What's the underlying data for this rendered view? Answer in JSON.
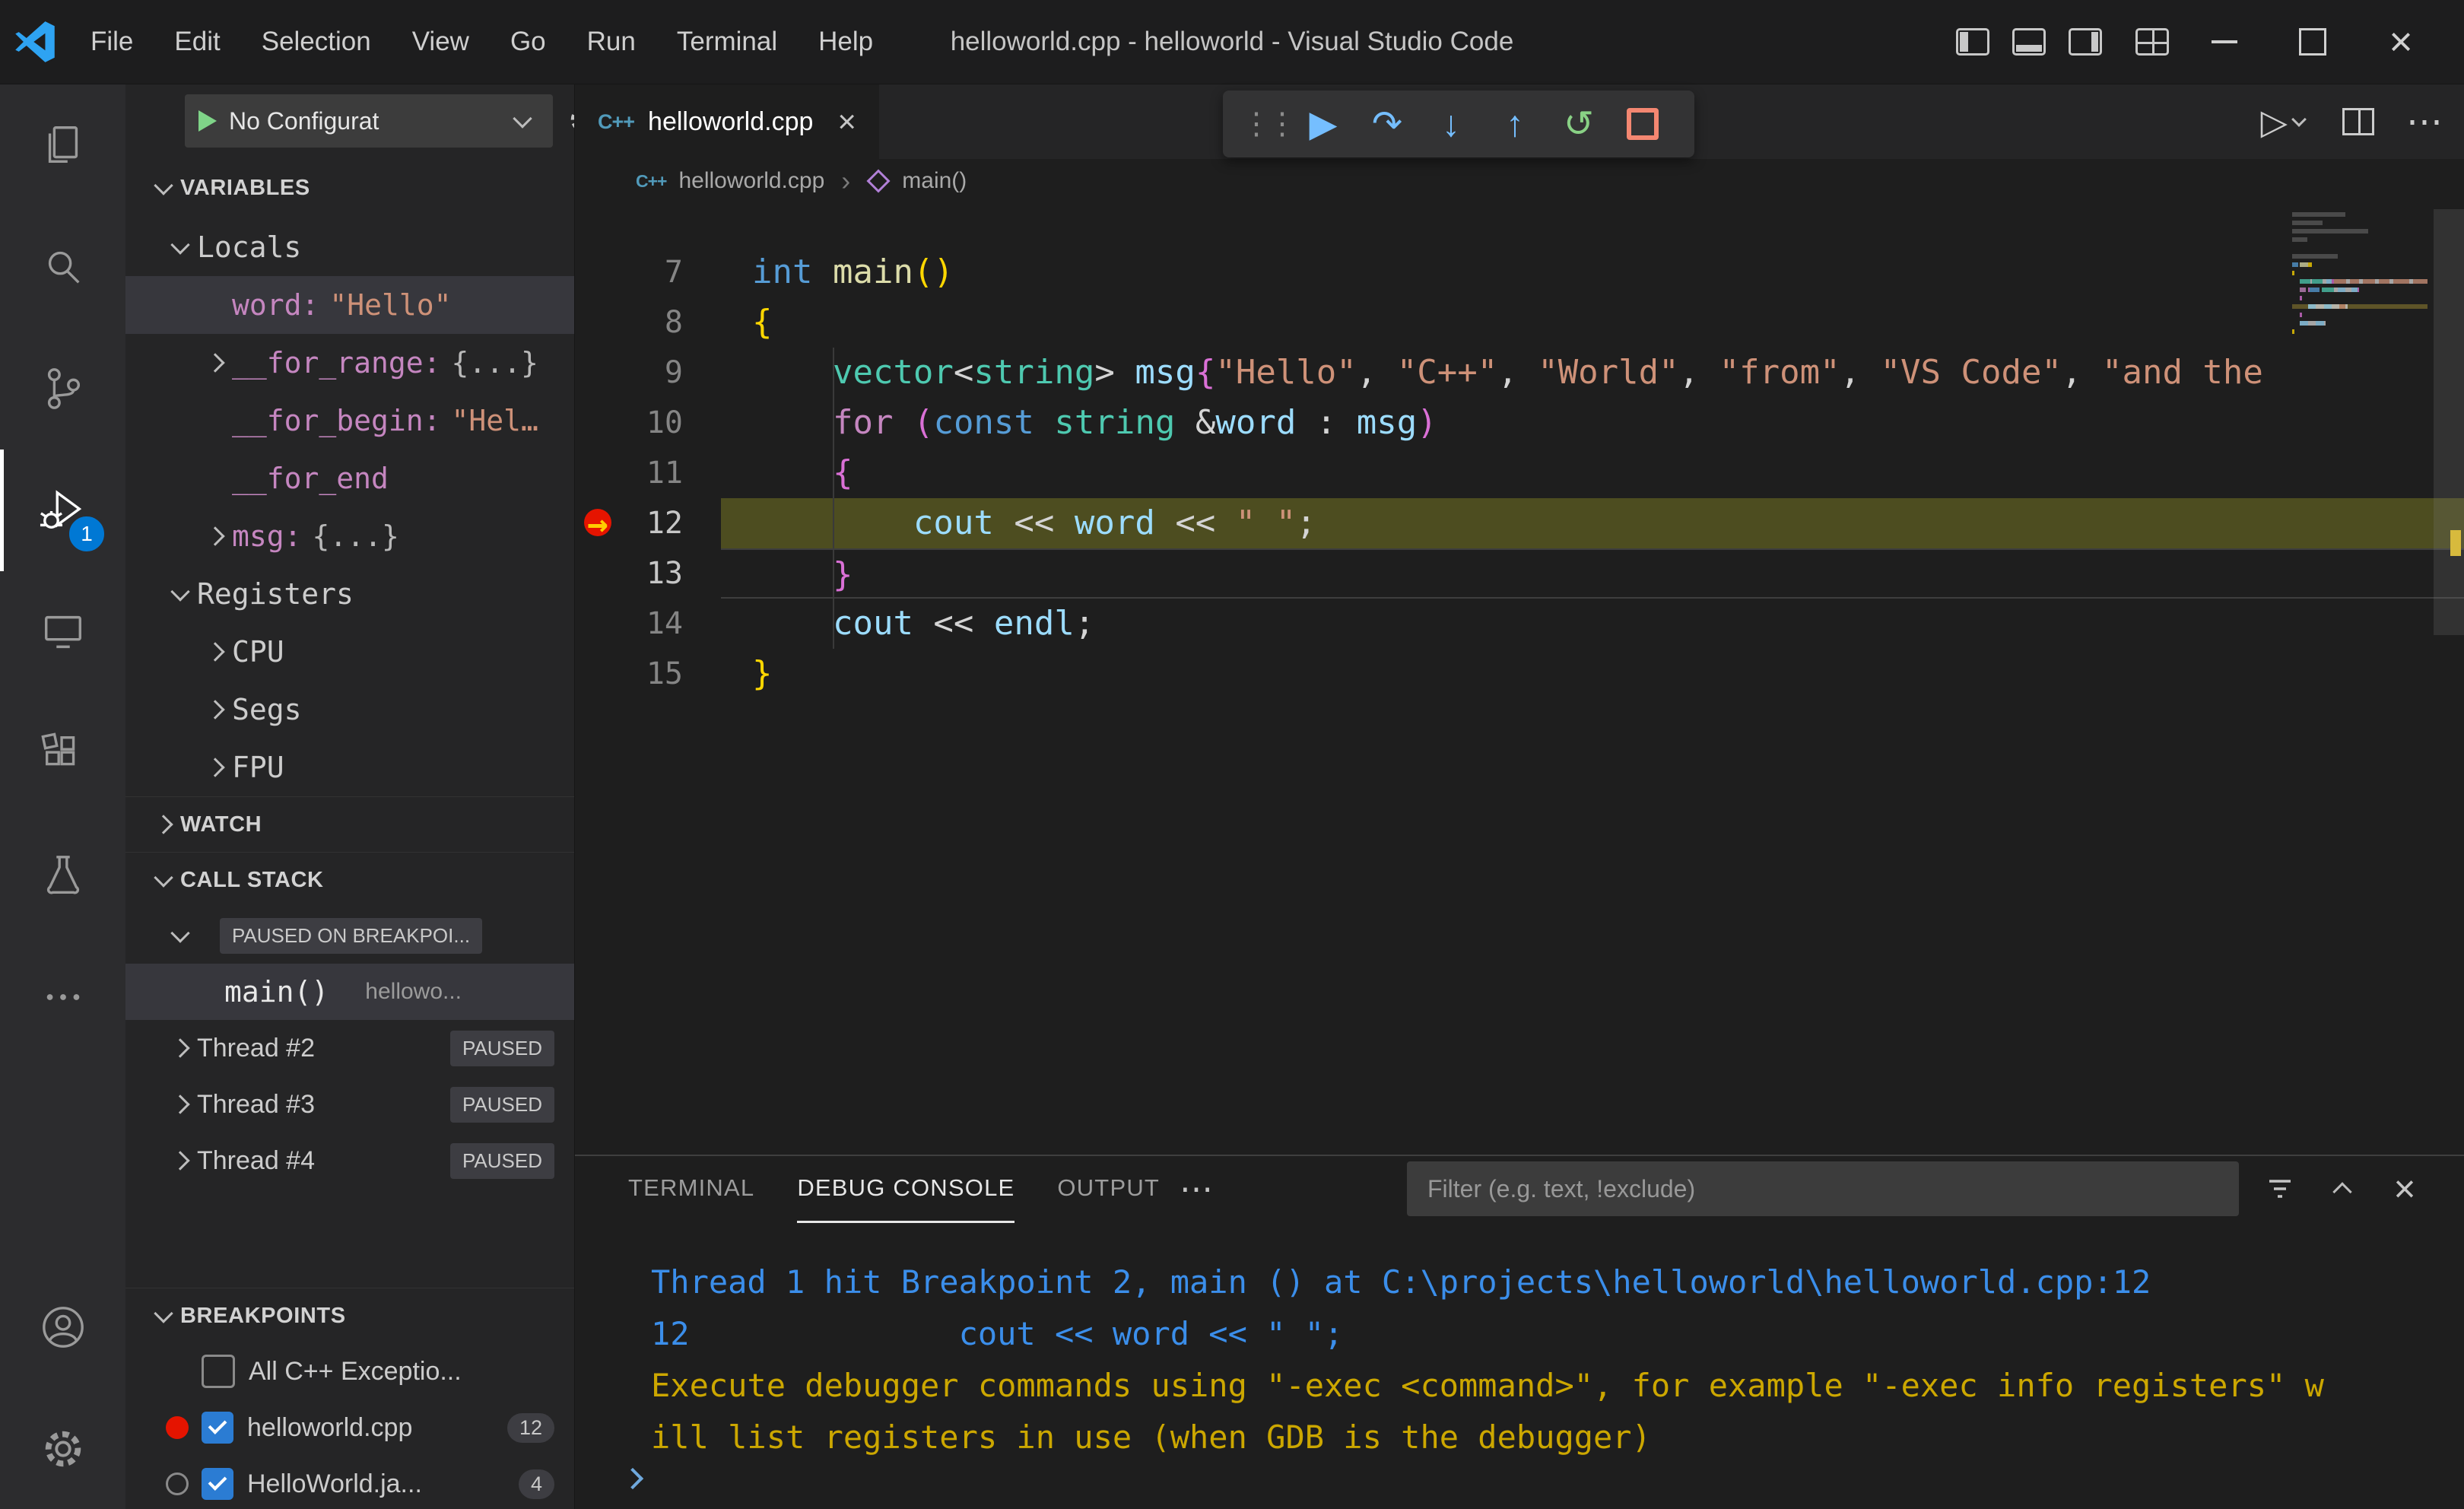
{
  "colors": {
    "kw": "#569cd6",
    "ctrl": "#c586c0",
    "type": "#4ec9b0",
    "fn": "#dcdcaa",
    "var": "#9cdcfe",
    "str": "#ce9178",
    "pl": "#d4d4d4",
    "brk1": "#ffd700",
    "brk2": "#da70d6",
    "lineno": "#858585",
    "debug_line_bg": "#4d4d20",
    "console_blue": "#3b8eea",
    "console_yellow": "#cca700",
    "accent": "#0078d4"
  },
  "titlebar": {
    "menus": [
      "File",
      "Edit",
      "Selection",
      "View",
      "Go",
      "Run",
      "Terminal",
      "Help"
    ],
    "title": "helloworld.cpp - helloworld - Visual Studio Code",
    "window_icons": [
      "layout-sidebar-left",
      "layout-panel-bottom",
      "layout-sidebar-right",
      "customize-layout",
      "minimize",
      "maximize",
      "close"
    ]
  },
  "activity": {
    "items": [
      "explorer",
      "search",
      "source-control",
      "run-and-debug",
      "remote-explorer",
      "extensions",
      "testing",
      "more"
    ],
    "bottom_items": [
      "account",
      "settings"
    ],
    "active": "run-and-debug",
    "badge": "1"
  },
  "sidebar": {
    "config": {
      "label": "No Configurat"
    },
    "sections": {
      "variables": "VARIABLES",
      "watch": "WATCH",
      "callstack": "CALL STACK",
      "breakpoints": "BREAKPOINTS"
    },
    "variables_rows": [
      {
        "indent": 1,
        "chev": "down",
        "name": "Locals",
        "ncls": "plain"
      },
      {
        "indent": 2,
        "chev": "none",
        "name": "word:",
        "ncls": "vname",
        "value": "\"Hello\"",
        "vcls": "vstr",
        "sel": true
      },
      {
        "indent": 2,
        "chev": "right",
        "name": "__for_range:",
        "ncls": "vname",
        "value": "{...}",
        "vcls": "vobj"
      },
      {
        "indent": 2,
        "chev": "none",
        "name": "__for_begin:",
        "ncls": "vname",
        "value": "\"Hel…",
        "vcls": "vstr"
      },
      {
        "indent": 2,
        "chev": "none",
        "name": "__for_end",
        "ncls": "vname"
      },
      {
        "indent": 2,
        "chev": "right",
        "name": "msg:",
        "ncls": "vname",
        "value": "{...}",
        "vcls": "vobj"
      },
      {
        "indent": 1,
        "chev": "down",
        "name": "Registers",
        "ncls": "plain"
      },
      {
        "indent": 2,
        "chev": "right",
        "name": "CPU",
        "ncls": "plain"
      },
      {
        "indent": 2,
        "chev": "right",
        "name": "Segs",
        "ncls": "plain"
      },
      {
        "indent": 2,
        "chev": "right",
        "name": "FPU",
        "ncls": "plain"
      }
    ],
    "callstack": {
      "paused_badge": "PAUSED ON BREAKPOI...",
      "frame": {
        "name": "main()",
        "file": "hellowo..."
      },
      "threads": [
        {
          "name": "Thread #2",
          "badge": "PAUSED"
        },
        {
          "name": "Thread #3",
          "badge": "PAUSED"
        },
        {
          "name": "Thread #4",
          "badge": "PAUSED"
        }
      ]
    },
    "breakpoints": [
      {
        "lead": "none",
        "checked": false,
        "label": "All C++ Exceptio...",
        "count": ""
      },
      {
        "lead": "red",
        "checked": true,
        "label": "helloworld.cpp",
        "count": "12"
      },
      {
        "lead": "gray",
        "checked": true,
        "label": "HelloWorld.ja...",
        "count": "4"
      }
    ]
  },
  "editor": {
    "tab": {
      "label": "helloworld.cpp",
      "icon": "C++"
    },
    "breadcrumb": {
      "file": "helloworld.cpp",
      "symbol": "main()"
    },
    "actions": [
      "run-or-debug",
      "split-editor",
      "more-actions"
    ],
    "toolbar": [
      {
        "name": "drag-handle",
        "glyph": "⋮⋮",
        "cls": "grip"
      },
      {
        "name": "continue",
        "glyph": "▶",
        "cls": "blue"
      },
      {
        "name": "step-over",
        "glyph": "↷",
        "cls": "blue"
      },
      {
        "name": "step-into",
        "glyph": "↓",
        "cls": "blue"
      },
      {
        "name": "step-out",
        "glyph": "↑",
        "cls": "blue"
      },
      {
        "name": "restart",
        "glyph": "↺",
        "cls": "green"
      },
      {
        "name": "stop",
        "glyph": "",
        "cls": "red"
      }
    ],
    "lines": [
      {
        "num": "7",
        "tokens": [
          {
            "t": "int",
            "c": "kw"
          },
          {
            "t": " ",
            "c": "pl"
          },
          {
            "t": "main",
            "c": "fn"
          },
          {
            "t": "()",
            "c": "brk1"
          }
        ]
      },
      {
        "num": "8",
        "tokens": [
          {
            "t": "{",
            "c": "brk1"
          }
        ]
      },
      {
        "num": "9",
        "guide": true,
        "tokens": [
          {
            "t": "    ",
            "c": "pl"
          },
          {
            "t": "vector",
            "c": "type"
          },
          {
            "t": "<",
            "c": "pl"
          },
          {
            "t": "string",
            "c": "type"
          },
          {
            "t": "> ",
            "c": "pl"
          },
          {
            "t": "msg",
            "c": "var"
          },
          {
            "t": "{",
            "c": "brk2"
          },
          {
            "t": "\"Hello\"",
            "c": "str"
          },
          {
            "t": ", ",
            "c": "pl"
          },
          {
            "t": "\"C++\"",
            "c": "str"
          },
          {
            "t": ", ",
            "c": "pl"
          },
          {
            "t": "\"World\"",
            "c": "str"
          },
          {
            "t": ", ",
            "c": "pl"
          },
          {
            "t": "\"from\"",
            "c": "str"
          },
          {
            "t": ", ",
            "c": "pl"
          },
          {
            "t": "\"VS Code\"",
            "c": "str"
          },
          {
            "t": ", ",
            "c": "pl"
          },
          {
            "t": "\"and the",
            "c": "str"
          }
        ]
      },
      {
        "num": "10",
        "guide": true,
        "tokens": [
          {
            "t": "    ",
            "c": "pl"
          },
          {
            "t": "for",
            "c": "ctrl"
          },
          {
            "t": " ",
            "c": "pl"
          },
          {
            "t": "(",
            "c": "brk2"
          },
          {
            "t": "const",
            "c": "kw"
          },
          {
            "t": " ",
            "c": "pl"
          },
          {
            "t": "string",
            "c": "type"
          },
          {
            "t": " &",
            "c": "pl"
          },
          {
            "t": "word",
            "c": "var"
          },
          {
            "t": " : ",
            "c": "pl"
          },
          {
            "t": "msg",
            "c": "var"
          },
          {
            "t": ")",
            "c": "brk2"
          }
        ]
      },
      {
        "num": "11",
        "guide": true,
        "tokens": [
          {
            "t": "    ",
            "c": "pl"
          },
          {
            "t": "{",
            "c": "brk2"
          }
        ]
      },
      {
        "num": "12",
        "guide": true,
        "debug": true,
        "tokens": [
          {
            "t": "        ",
            "c": "pl"
          },
          {
            "t": "cout",
            "c": "var"
          },
          {
            "t": " << ",
            "c": "pl"
          },
          {
            "t": "word",
            "c": "var"
          },
          {
            "t": " << ",
            "c": "pl"
          },
          {
            "t": "\" \"",
            "c": "str"
          },
          {
            "t": ";",
            "c": "pl"
          }
        ]
      },
      {
        "num": "13",
        "guide": true,
        "cursor": true,
        "tokens": [
          {
            "t": "    ",
            "c": "pl"
          },
          {
            "t": "}",
            "c": "brk2"
          }
        ]
      },
      {
        "num": "14",
        "guide": true,
        "tokens": [
          {
            "t": "    ",
            "c": "pl"
          },
          {
            "t": "cout",
            "c": "var"
          },
          {
            "t": " << ",
            "c": "pl"
          },
          {
            "t": "endl",
            "c": "var"
          },
          {
            "t": ";",
            "c": "pl"
          }
        ]
      },
      {
        "num": "15",
        "tokens": [
          {
            "t": "}",
            "c": "brk1"
          }
        ]
      }
    ]
  },
  "panel": {
    "tabs": [
      {
        "label": "TERMINAL",
        "active": false
      },
      {
        "label": "DEBUG CONSOLE",
        "active": true
      },
      {
        "label": "OUTPUT",
        "active": false
      }
    ],
    "tabs_more": "⋯",
    "filter_placeholder": "Filter (e.g. text, !exclude)",
    "actions": [
      "filter",
      "collapse-panel",
      "close-panel"
    ],
    "console": [
      {
        "cls": "c-blue",
        "text": "Thread 1 hit Breakpoint 2, main () at C:\\projects\\helloworld\\helloworld.cpp:12"
      },
      {
        "cls": "c-blue",
        "text": "12              cout << word << \" \";"
      },
      {
        "cls": "c-yellow",
        "text": "Execute debugger commands using \"-exec <command>\", for example \"-exec info registers\" w"
      },
      {
        "cls": "c-yellow",
        "text": "ill list registers in use (when GDB is the debugger)"
      }
    ]
  }
}
